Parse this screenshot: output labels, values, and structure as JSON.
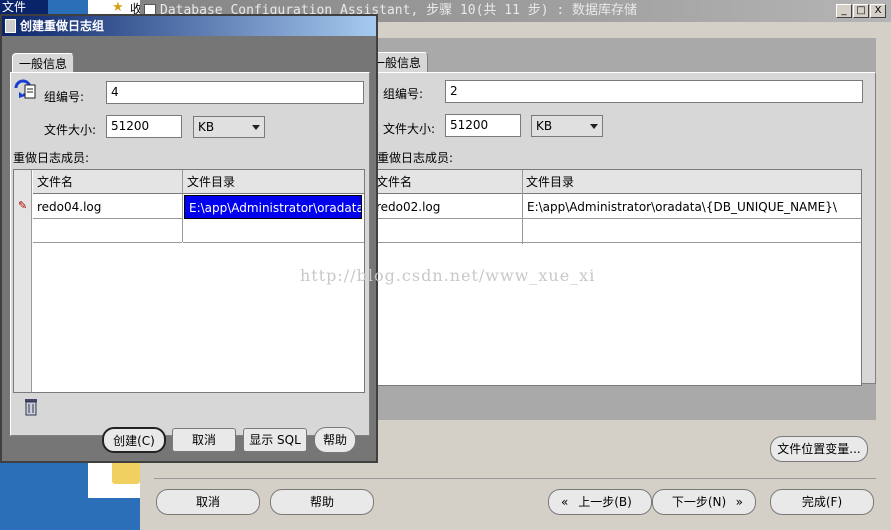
{
  "desktop": {
    "file_label": "文件",
    "shortcut_label": "收"
  },
  "main_window": {
    "title": "Database Configuration Assistant, 步骤 10(共 11 步) : 数据库存储",
    "controls": {
      "minimize": "_",
      "maximize": "□",
      "close": "X"
    },
    "tab_label": "一般信息",
    "group_number_label": "组编号:",
    "group_number_value": "2",
    "file_size_label": "文件大小:",
    "file_size_value": "51200",
    "unit_value": "KB",
    "members_label": "重做日志成员:",
    "columns": [
      "文件名",
      "文件目录"
    ],
    "rows": [
      {
        "file_name": "redo02.log",
        "directory": "E:\\app\\Administrator\\oradata\\{DB_UNIQUE_NAME}\\"
      }
    ],
    "file_location_button": "文件位置变量...",
    "cancel_button": "取消",
    "help_button": "帮助",
    "back_button": "上一步(B)",
    "next_button": "下一步(N)",
    "finish_button": "完成(F)"
  },
  "dialog": {
    "title": "创建重做日志组",
    "tab_label": "一般信息",
    "group_number_label": "组编号:",
    "group_number_value": "4",
    "file_size_label": "文件大小:",
    "file_size_value": "51200",
    "unit_value": "KB",
    "members_label": "重做日志成员:",
    "columns": [
      "文件名",
      "文件目录"
    ],
    "rows": [
      {
        "file_name": "redo04.log",
        "directory": "E:\\app\\Administrator\\oradata\\..."
      }
    ],
    "create_button": "创建(C)",
    "cancel_button": "取消",
    "show_sql_button": "显示 SQL",
    "help_button": "帮助"
  },
  "watermark": "http://blog.csdn.net/www_xue_xi"
}
